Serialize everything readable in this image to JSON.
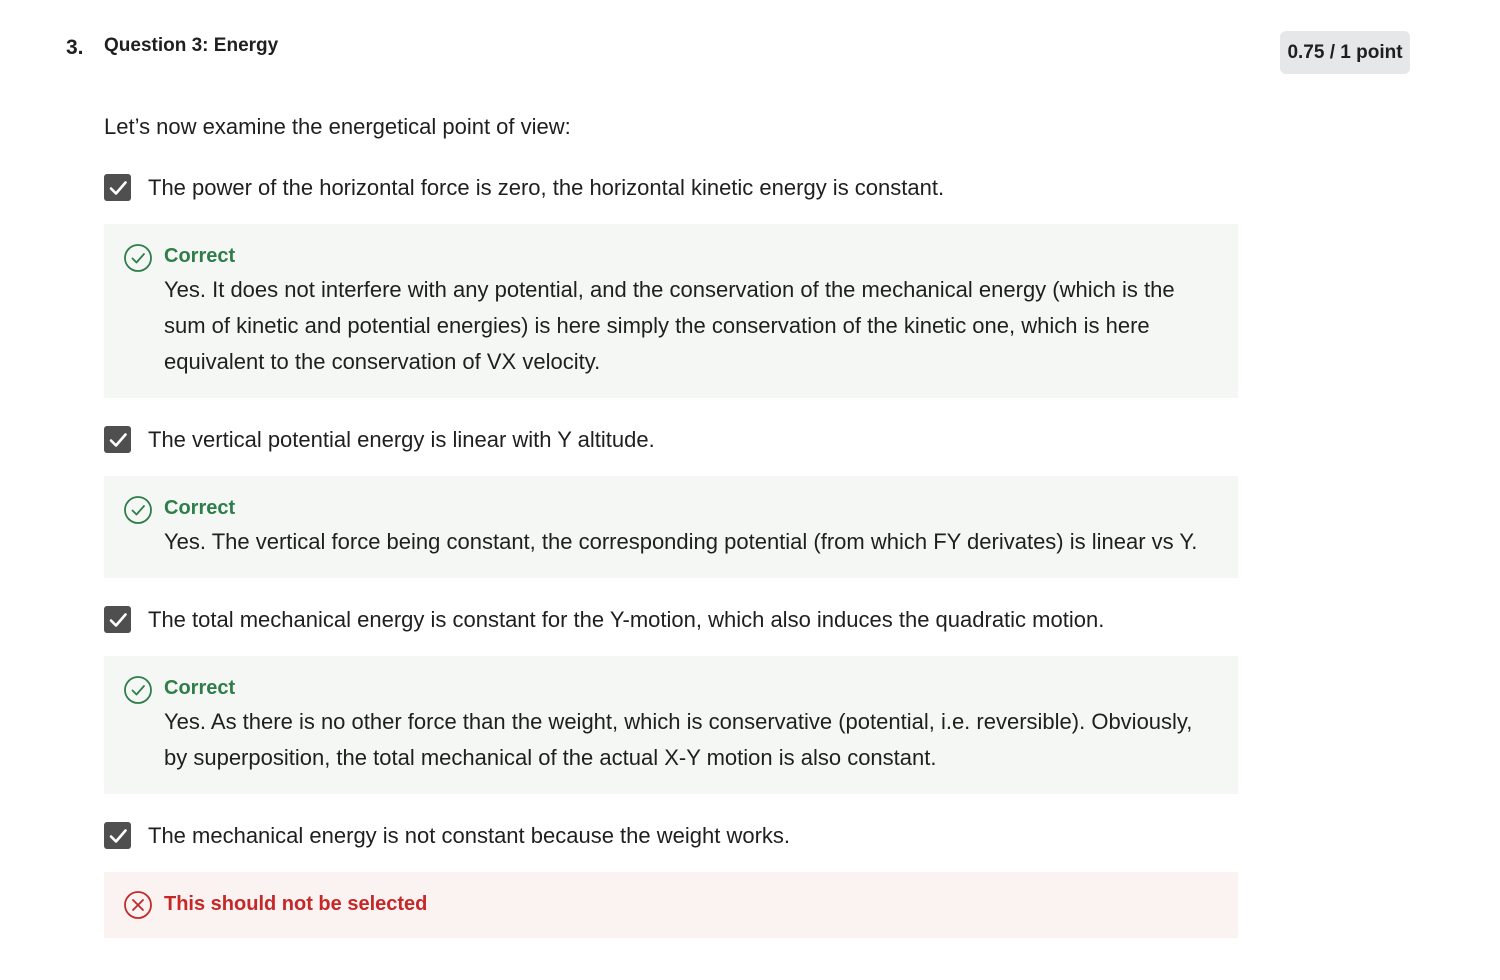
{
  "question": {
    "number": "3.",
    "title": "Question 3: Energy",
    "score": "0.75 / 1 point",
    "prompt": "Let’s now examine the energetical point of view:"
  },
  "options": [
    {
      "text": "The power of the horizontal force is zero, the horizontal kinetic energy is constant.",
      "checked": true,
      "feedback_status": "Correct",
      "feedback_text": "Yes. It does not interfere with any potential, and the conservation of the mechanical energy (which is the sum of kinetic and potential energies) is here simply the conservation of the kinetic one, which is here equivalent to the conservation of VX velocity."
    },
    {
      "text": "The vertical potential energy is linear with Y altitude.",
      "checked": true,
      "feedback_status": "Correct",
      "feedback_text": "Yes. The vertical force being constant, the corresponding potential (from which FY derivates) is linear vs Y."
    },
    {
      "text": "The total mechanical energy is constant for the Y-motion, which also induces the quadratic motion.",
      "checked": true,
      "feedback_status": "Correct",
      "feedback_text": "Yes. As there is no other force than the weight, which is conservative (potential, i.e. reversible). Obviously, by superposition, the total mechanical of the actual X-Y motion is also constant."
    },
    {
      "text": "The mechanical energy is not constant because the weight works.",
      "checked": true,
      "feedback_status": "This should not be selected",
      "feedback_text": ""
    }
  ],
  "colors": {
    "correct": "#2e7d4a",
    "incorrect": "#c62828",
    "checkbox": "#4f4f4f",
    "badge_bg": "#e5e7e8"
  },
  "icons": {
    "checkbox": "checkmark-icon",
    "correct": "check-circle-icon",
    "incorrect": "x-circle-icon"
  }
}
